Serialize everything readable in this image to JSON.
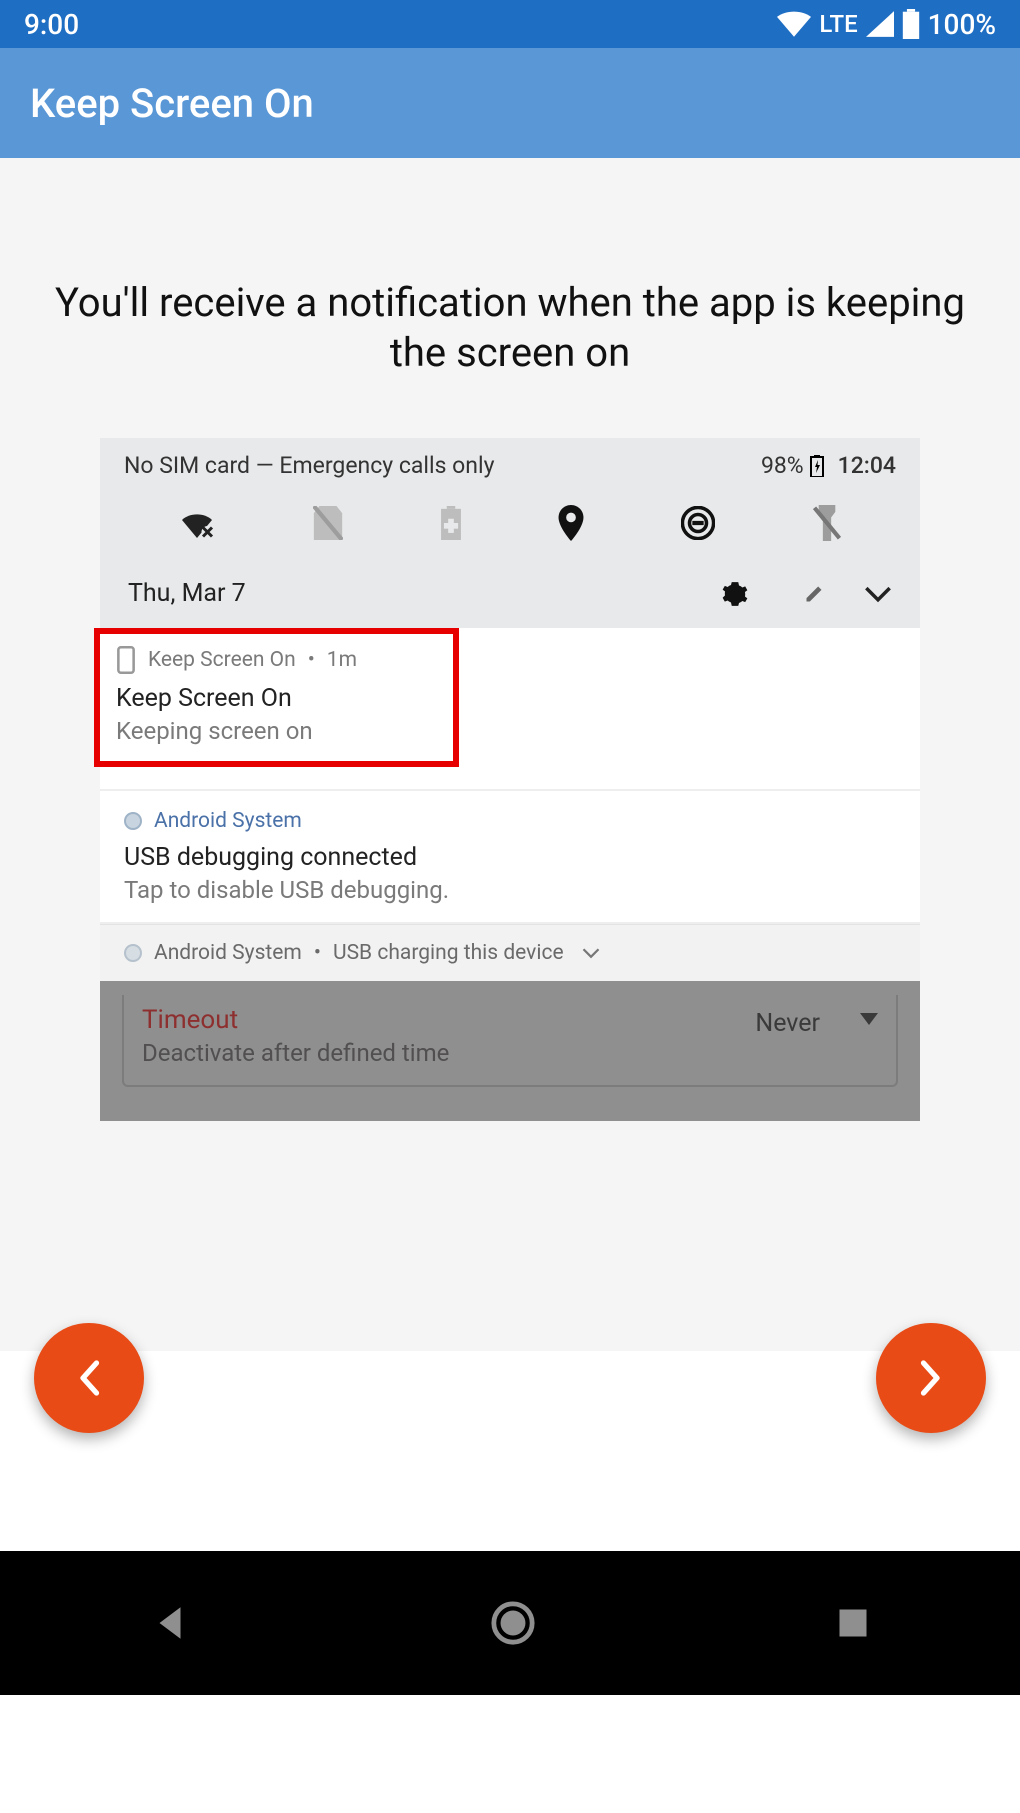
{
  "outer_status": {
    "time": "9:00",
    "network": "LTE",
    "battery": "100%"
  },
  "app_bar": {
    "title": "Keep Screen On"
  },
  "headline": "You'll receive a notification when the app is keeping the screen on",
  "inner": {
    "status_left": "No SIM card — Emergency calls only",
    "battery": "98%",
    "time": "12:04",
    "date": "Thu, Mar 7"
  },
  "notif1": {
    "app": "Keep Screen On",
    "age": "1m",
    "title": "Keep Screen On",
    "subtitle": "Keeping screen on"
  },
  "notif2": {
    "app": "Android System",
    "title": "USB debugging connected",
    "subtitle": "Tap to disable USB debugging."
  },
  "collapsed": {
    "app": "Android System",
    "text": "USB charging this device"
  },
  "underlay": {
    "title": "Timeout",
    "subtitle": "Deactivate after defined time",
    "value": "Never"
  }
}
